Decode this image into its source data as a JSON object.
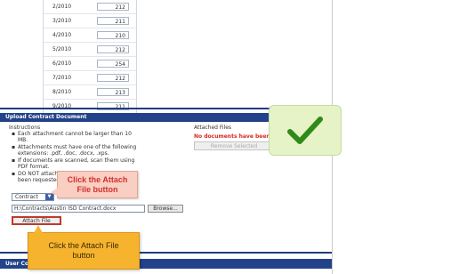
{
  "months": [
    {
      "label": "2/2010",
      "value": "212"
    },
    {
      "label": "3/2010",
      "value": "211"
    },
    {
      "label": "4/2010",
      "value": "210"
    },
    {
      "label": "5/2010",
      "value": "212"
    },
    {
      "label": "6/2010",
      "value": "254"
    },
    {
      "label": "7/2010",
      "value": "212"
    },
    {
      "label": "8/2010",
      "value": "213"
    },
    {
      "label": "9/2010",
      "value": "211"
    }
  ],
  "upload": {
    "header": "Upload Contract Document",
    "instructions_title": "Instructions",
    "instructions": [
      "Each attachment cannot be larger than 10 MB.",
      "Attachments must have one of the following extensions: .pdf, .doc, .docx, .xps.",
      "If documents are scanned, scan them using PDF format.",
      "DO NOT attach documents that have not been requested."
    ],
    "attached_title": "Attached Files",
    "no_documents": "No documents have been attached.",
    "remove_label": "Remove Selected",
    "doc_type": "Contract",
    "file_path": "H:\\Contracts\\Austin ISD Contract.docx",
    "browse_label": "Browse...",
    "attach_label": "Attach File"
  },
  "callouts": {
    "red_line1": "Click the Attach",
    "red_line2": "File button",
    "yellow_line1": "Click the Attach File",
    "yellow_line2": "button"
  },
  "user_comments_header": "User Comments",
  "colors": {
    "header_blue": "#22428a",
    "check_green": "#2f8a19"
  }
}
